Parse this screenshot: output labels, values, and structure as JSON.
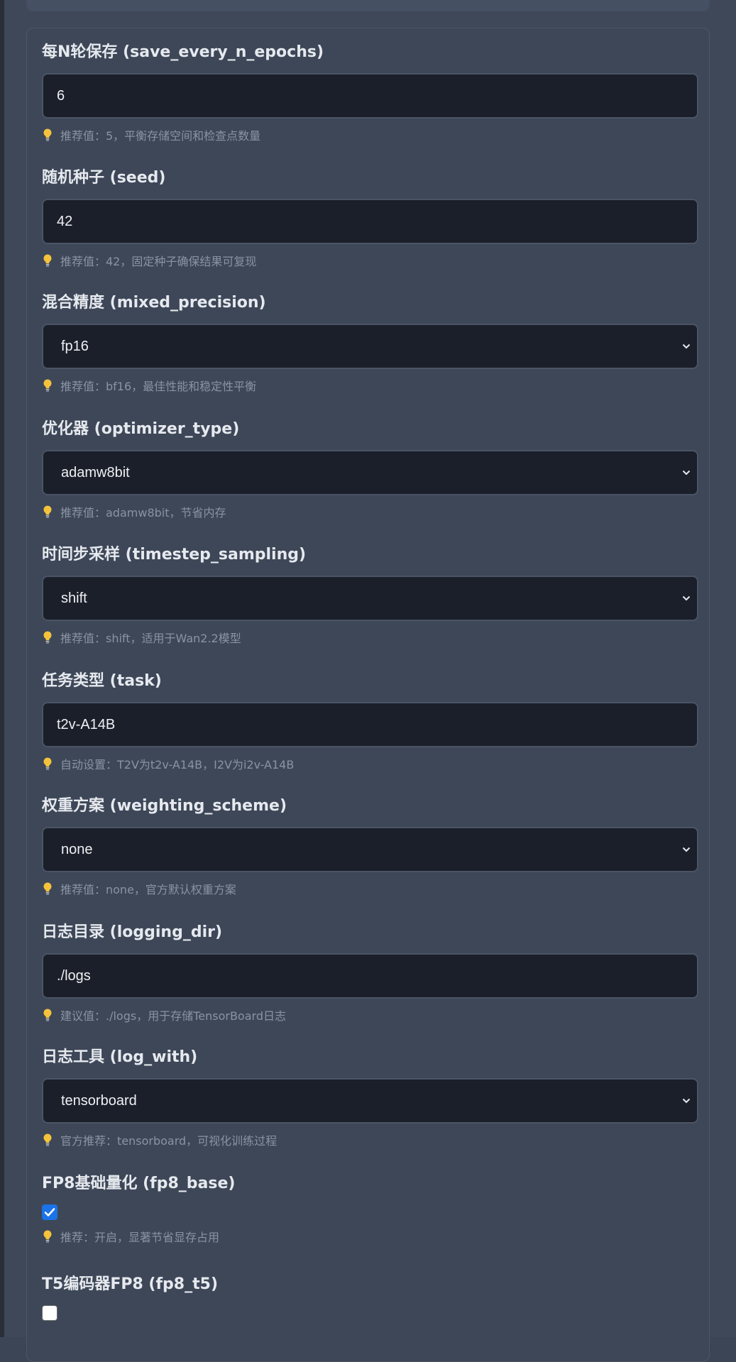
{
  "fields": [
    {
      "label": "每N轮保存 (save_every_n_epochs)",
      "type": "input",
      "value": "6",
      "hint": "推荐值：5，平衡存储空间和检查点数量"
    },
    {
      "label": "随机种子 (seed)",
      "type": "input",
      "value": "42",
      "hint": "推荐值：42，固定种子确保结果可复现"
    },
    {
      "label": "混合精度 (mixed_precision)",
      "type": "select",
      "value": "fp16",
      "hint": "推荐值：bf16，最佳性能和稳定性平衡"
    },
    {
      "label": "优化器 (optimizer_type)",
      "type": "select",
      "value": "adamw8bit",
      "hint": "推荐值：adamw8bit，节省内存"
    },
    {
      "label": "时间步采样 (timestep_sampling)",
      "type": "select",
      "value": "shift",
      "hint": "推荐值：shift，适用于Wan2.2模型"
    },
    {
      "label": "任务类型 (task)",
      "type": "input",
      "value": "t2v-A14B",
      "hint": "自动设置：T2V为t2v-A14B，I2V为i2v-A14B"
    },
    {
      "label": "权重方案 (weighting_scheme)",
      "type": "select",
      "value": "none",
      "hint": "推荐值：none，官方默认权重方案"
    },
    {
      "label": "日志目录 (logging_dir)",
      "type": "input",
      "value": "./logs",
      "hint": "建议值：./logs，用于存储TensorBoard日志"
    },
    {
      "label": "日志工具 (log_with)",
      "type": "select",
      "value": "tensorboard",
      "hint": "官方推荐：tensorboard，可视化训练过程"
    },
    {
      "label": "FP8基础量化 (fp8_base)",
      "type": "checkbox",
      "checked": true,
      "hint": "推荐：开启，显著节省显存占用"
    },
    {
      "label": "T5编码器FP8 (fp8_t5)",
      "type": "checkbox",
      "checked": false
    }
  ],
  "colors": {
    "accent": "#1a73e8",
    "hint_icon": "#f5c33b",
    "input_bg": "#1b1f29",
    "panel_bg": "#3d4758"
  }
}
